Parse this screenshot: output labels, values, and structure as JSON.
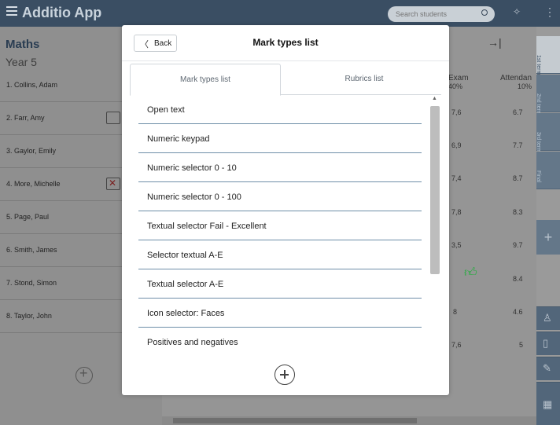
{
  "app": {
    "title": "Additio App",
    "search_placeholder": "Search students",
    "menu_icon": "hamburger-menu-icon",
    "wand_icon": "magic-wand-icon",
    "more_icon": "more-vertical-icon"
  },
  "class": {
    "name": "Maths",
    "year": "Year 5"
  },
  "students": [
    {
      "name": "1. Collins, Adam",
      "exam": "7,6",
      "attendance": "6.7"
    },
    {
      "name": "2. Farr, Amy",
      "exam": "6,9",
      "attendance": "7.7",
      "icon": "person-with-board-icon"
    },
    {
      "name": "3. Gaylor, Emily",
      "exam": "7,4",
      "attendance": "8.7"
    },
    {
      "name": "4. More, Michelle",
      "exam": "7,8",
      "attendance": "8.3",
      "icon": "crossed-image-icon"
    },
    {
      "name": "5. Page, Paul",
      "exam": "3,5",
      "attendance": "9.7"
    },
    {
      "name": "6. Smith, James",
      "exam": "",
      "attendance": "8.4"
    },
    {
      "name": "7. Stond, Simon",
      "exam": "8",
      "attendance": "4.6"
    },
    {
      "name": "8. Taylor, John",
      "exam": "7,6",
      "attendance": "5"
    }
  ],
  "columns": {
    "exam": {
      "label": "Exam",
      "pct": "40%"
    },
    "attendance": {
      "label": "Attendan",
      "pct": "10%"
    }
  },
  "terms": [
    "1st term",
    "2nd term",
    "3rd term",
    "Final"
  ],
  "tools": [
    "person-icon",
    "book-icon",
    "pencil-icon",
    "table-icon"
  ],
  "modal": {
    "back_label": "Back",
    "title": "Mark types list",
    "tabs": [
      {
        "label": "Mark types list",
        "active": true
      },
      {
        "label": "Rubrics list",
        "active": false
      }
    ],
    "items": [
      "Open text",
      "Numeric keypad",
      "Numeric selector 0 - 10",
      "Numeric selector 0 - 100",
      "Textual selector Fail - Excellent",
      "Selector textual A-E",
      "Textual selector A-E",
      "Icon selector: Faces",
      "Positives and negatives"
    ]
  },
  "colors": {
    "topbar": "#3a4e63",
    "accent": "#6e8ea8",
    "thumb_green": "#1fae3a"
  }
}
